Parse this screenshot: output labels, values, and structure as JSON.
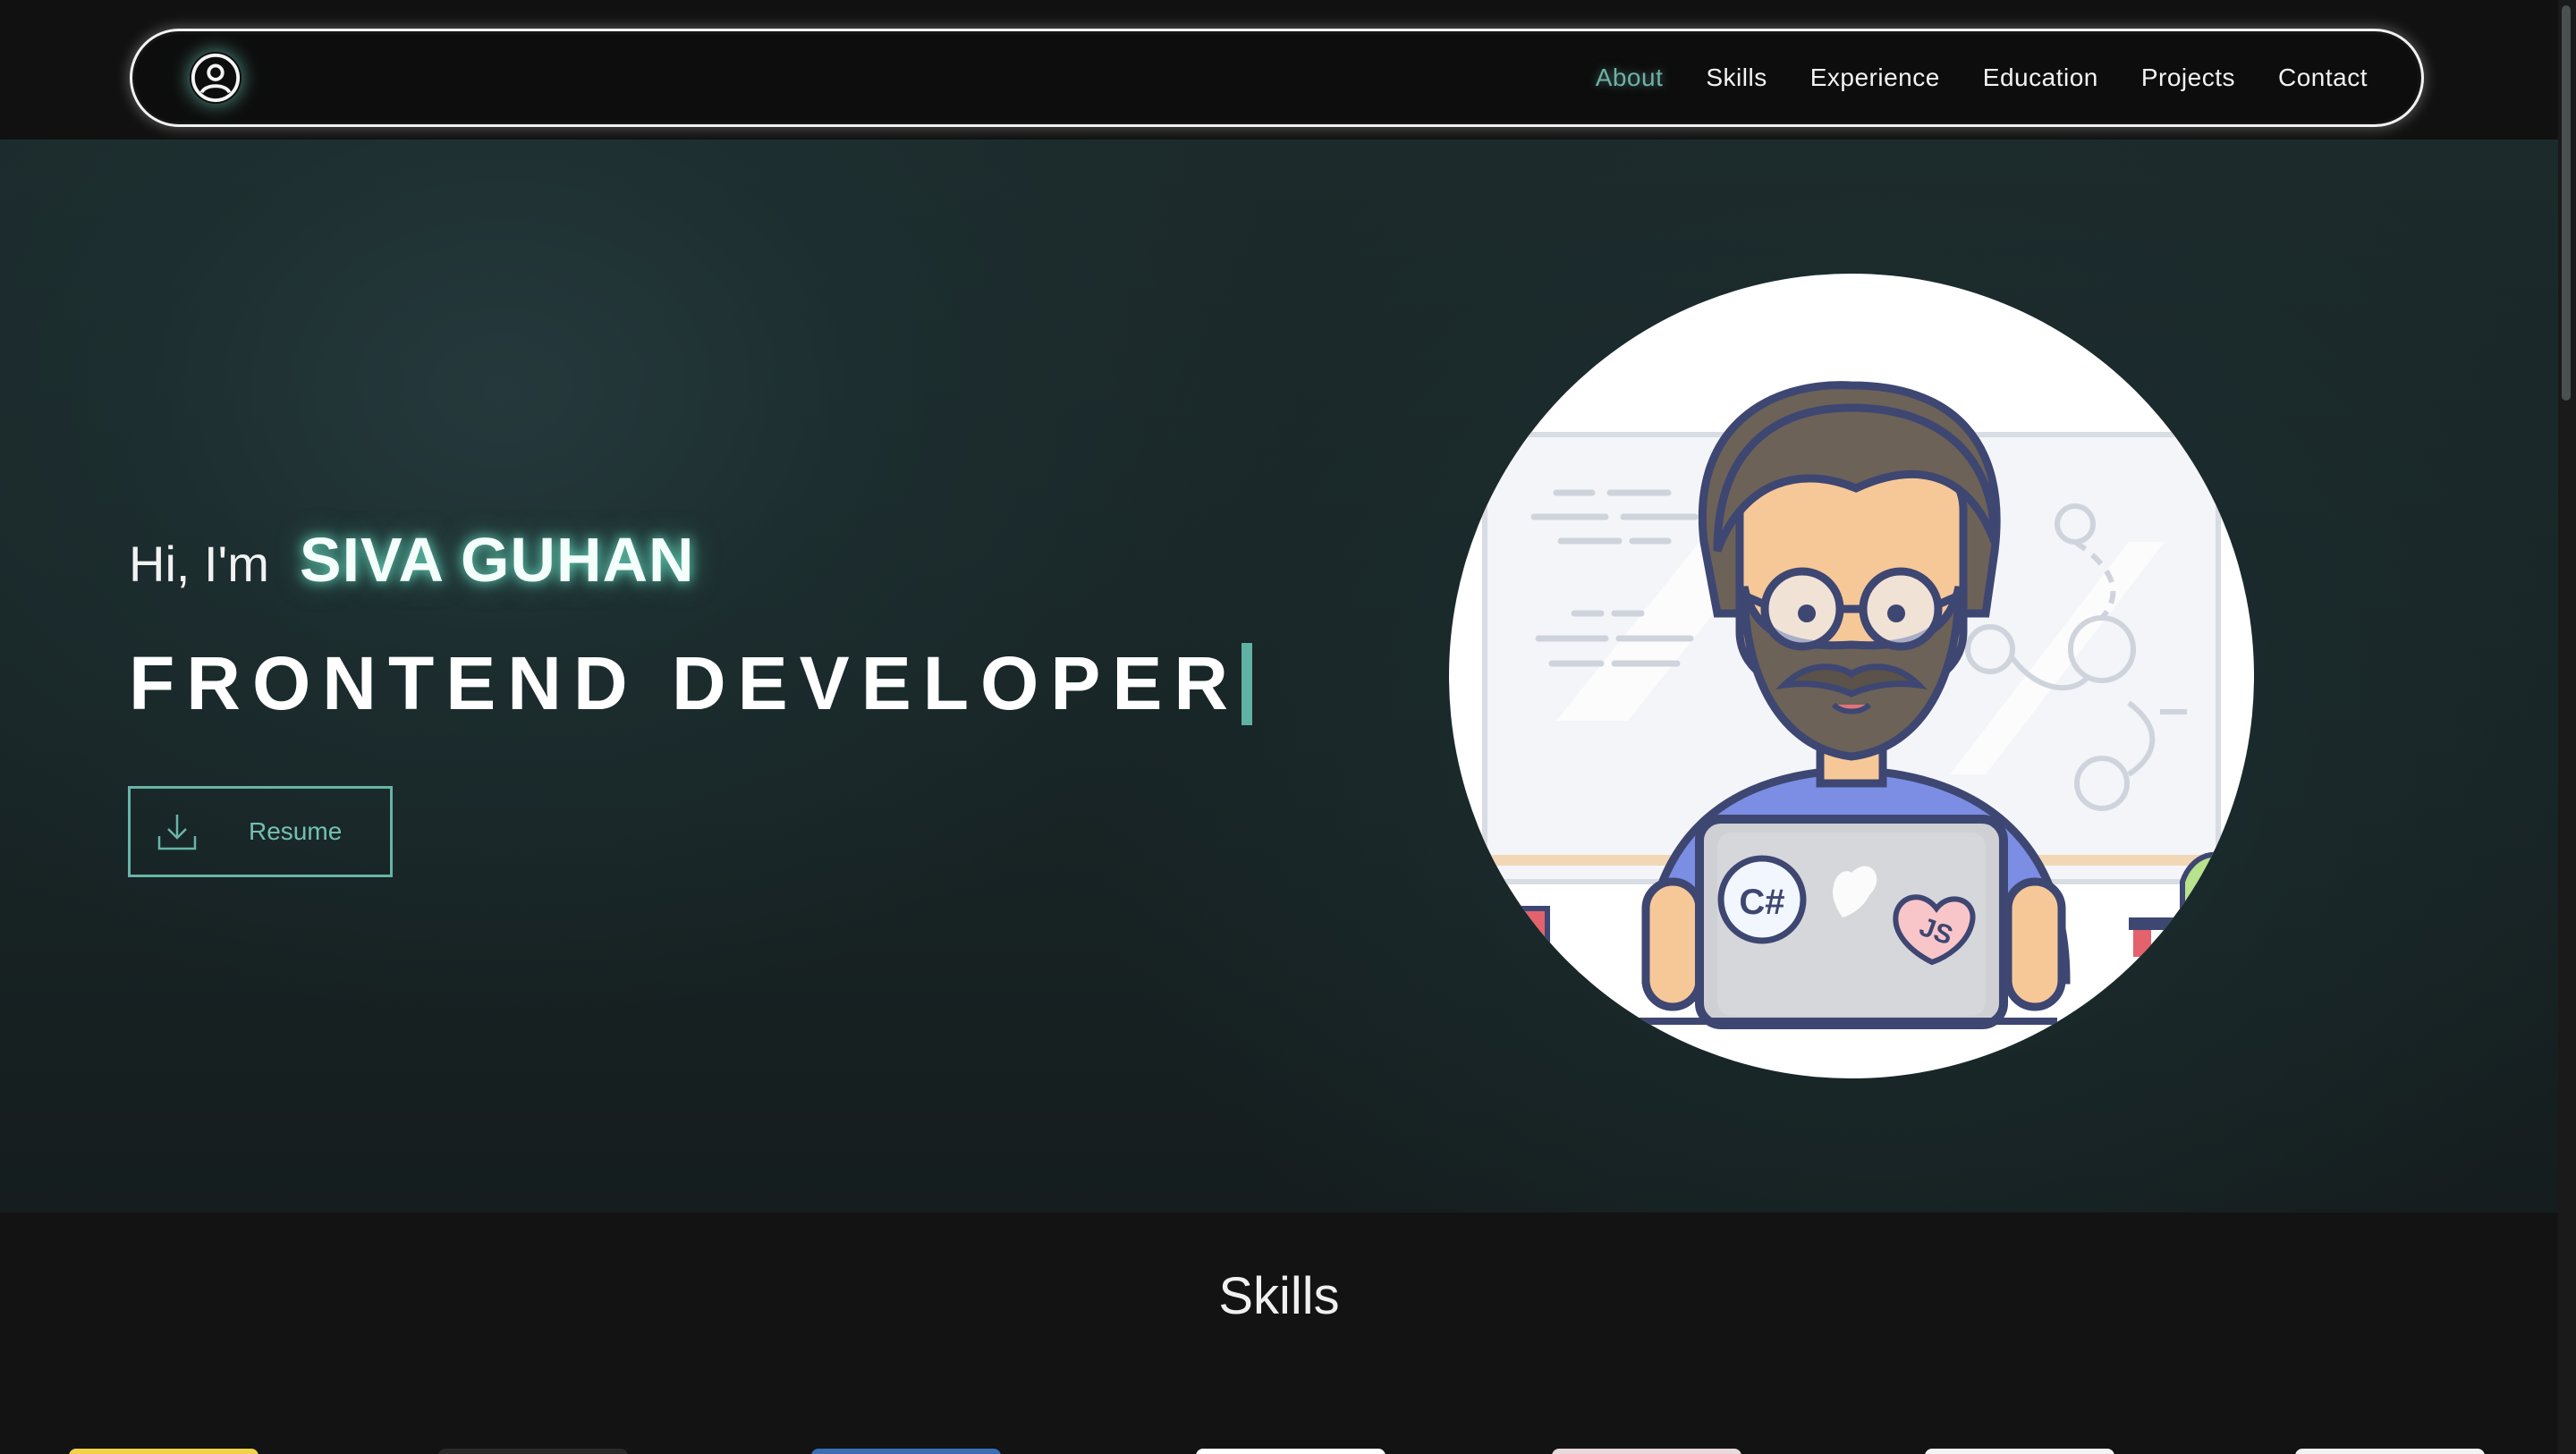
{
  "nav": {
    "logo_icon": "user-circle-icon",
    "links": [
      {
        "label": "About",
        "active": true
      },
      {
        "label": "Skills",
        "active": false
      },
      {
        "label": "Experience",
        "active": false
      },
      {
        "label": "Education",
        "active": false
      },
      {
        "label": "Projects",
        "active": false
      },
      {
        "label": "Contact",
        "active": false
      }
    ]
  },
  "hero": {
    "greeting": "Hi, I'm",
    "name": "SIVA GUHAN",
    "role": "FRONTEND DEVELOPER",
    "resume_button": {
      "label": "Resume",
      "icon": "download-icon"
    },
    "illustration": {
      "laptop_stickers": [
        "C#",
        "JS"
      ]
    }
  },
  "skills": {
    "title": "Skills",
    "card_colors": [
      "#f2d24a",
      "#2a2a2a",
      "#3a6fb8",
      "#ffffff",
      "#e9d8dc",
      "#f4f4f4",
      "#f2f2f2"
    ]
  },
  "colors": {
    "accent": "#67b5a7",
    "background": "#131313",
    "hero_bg": "#1c2a2b"
  }
}
